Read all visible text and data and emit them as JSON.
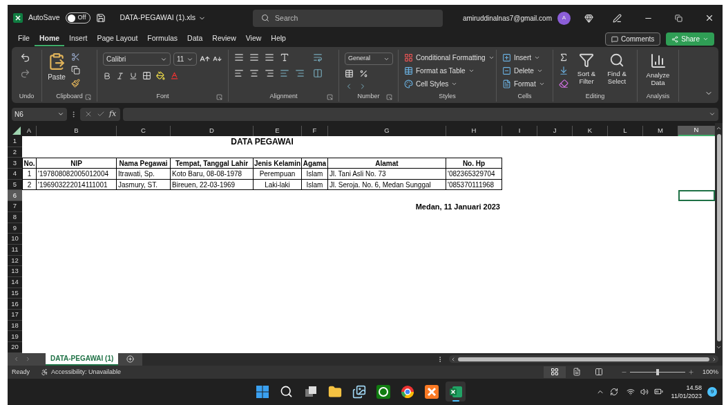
{
  "title_bar": {
    "autosave": {
      "label": "AutoSave",
      "on": false,
      "state_text": "Off"
    },
    "file_name": "DATA-PEGAWAI (1).xls",
    "search": {
      "placeholder": "Search"
    },
    "account": "amiruddinalnas7@gmail.com",
    "avatar": "A"
  },
  "menu_tabs": [
    {
      "label": "File",
      "selected": false
    },
    {
      "label": "Home",
      "selected": true
    },
    {
      "label": "Insert",
      "selected": false
    },
    {
      "label": "Page Layout",
      "selected": false
    },
    {
      "label": "Formulas",
      "selected": false
    },
    {
      "label": "Data",
      "selected": false
    },
    {
      "label": "Review",
      "selected": false
    },
    {
      "label": "View",
      "selected": false
    },
    {
      "label": "Help",
      "selected": false
    }
  ],
  "header_buttons": {
    "comments": "Comments",
    "share": "Share"
  },
  "ribbon": [
    {
      "kind": "undo",
      "label": "Undo"
    },
    {
      "kind": "clipboard",
      "label": "Clipboard",
      "paste": "Paste"
    },
    {
      "kind": "font",
      "label": "Font",
      "font_name": "Calibri",
      "font_size": "11"
    },
    {
      "kind": "alignment",
      "label": "Alignment"
    },
    {
      "kind": "number",
      "label": "Number",
      "format": "General"
    },
    {
      "kind": "styles",
      "label": "Styles",
      "items": [
        "Conditional Formatting",
        "Format as Table",
        "Cell Styles"
      ]
    },
    {
      "kind": "cells",
      "label": "Cells",
      "items": [
        "Insert",
        "Delete",
        "Format"
      ]
    },
    {
      "kind": "editing",
      "label": "Editing",
      "items": [
        "Sort & Filter",
        "Find & Select"
      ]
    },
    {
      "kind": "analysis",
      "label": "Analysis",
      "items": [
        "Analyze Data"
      ]
    }
  ],
  "formula_bar": {
    "name_box": "N6",
    "function_label": "fx"
  },
  "sheet": {
    "columns": [
      {
        "letter": "A",
        "selected": false
      },
      {
        "letter": "B",
        "selected": false
      },
      {
        "letter": "C",
        "selected": false
      },
      {
        "letter": "D",
        "selected": false
      },
      {
        "letter": "E",
        "selected": false
      },
      {
        "letter": "F",
        "selected": false
      },
      {
        "letter": "G",
        "selected": false
      },
      {
        "letter": "H",
        "selected": false
      },
      {
        "letter": "I",
        "selected": false
      },
      {
        "letter": "J",
        "selected": false
      },
      {
        "letter": "K",
        "selected": false
      },
      {
        "letter": "L",
        "selected": false
      },
      {
        "letter": "M",
        "selected": false
      },
      {
        "letter": "N",
        "selected": true
      }
    ],
    "rows": [
      {
        "number": "1",
        "selected": false,
        "kind": "title",
        "text": "DATA PEGAWAI"
      },
      {
        "number": "2",
        "selected": false,
        "kind": "blank"
      },
      {
        "number": "3",
        "selected": false,
        "kind": "header",
        "cells": [
          "No.",
          "NIP",
          "Nama Pegawai",
          "Tempat, Tanggal Lahir",
          "Jenis Kelamin",
          "Agama",
          "Alamat",
          "No. Hp"
        ]
      },
      {
        "number": "4",
        "selected": false,
        "kind": "record",
        "cells": [
          "1",
          "'197808082005012004",
          "Itrawati, Sp.",
          "Koto Baru, 08-08-1978",
          "Perempuan",
          "Islam",
          "Jl. Tani Asli No. 73",
          "'082365329704"
        ]
      },
      {
        "number": "5",
        "selected": false,
        "kind": "record",
        "cells": [
          "2",
          "'196903222014111001",
          "Jasmury, ST.",
          "Bireuen, 22-03-1969",
          "Laki-laki",
          "Islam",
          "Jl. Seroja. No. 6, Medan Sunggal",
          "'085370111968"
        ]
      },
      {
        "number": "6",
        "selected": true,
        "kind": "blank"
      },
      {
        "number": "7",
        "selected": false,
        "kind": "signature",
        "text": "Medan, 11 Januari 2023"
      },
      {
        "number": "8",
        "selected": false,
        "kind": "blank"
      },
      {
        "number": "9",
        "selected": false,
        "kind": "blank"
      },
      {
        "number": "10",
        "selected": false,
        "kind": "blank"
      },
      {
        "number": "11",
        "selected": false,
        "kind": "blank"
      },
      {
        "number": "12",
        "selected": false,
        "kind": "blank"
      },
      {
        "number": "13",
        "selected": false,
        "kind": "blank"
      },
      {
        "number": "14",
        "selected": false,
        "kind": "blank"
      },
      {
        "number": "15",
        "selected": false,
        "kind": "blank"
      },
      {
        "number": "16",
        "selected": false,
        "kind": "blank"
      },
      {
        "number": "17",
        "selected": false,
        "kind": "blank"
      },
      {
        "number": "18",
        "selected": false,
        "kind": "blank"
      },
      {
        "number": "19",
        "selected": false,
        "kind": "blank"
      },
      {
        "number": "20",
        "selected": false,
        "kind": "blank"
      }
    ]
  },
  "sheet_tabs": [
    {
      "label": "DATA-PEGAWAI (1)",
      "selected": true
    }
  ],
  "status_bar": {
    "ready": "Ready",
    "accessibility": "Accessibility: Unavailable",
    "views": [
      {
        "kind": "normal",
        "selected": true
      },
      {
        "kind": "page_layout",
        "selected": false
      },
      {
        "kind": "page_break",
        "selected": false
      }
    ],
    "zoom": {
      "level": 0.5,
      "reading": "100%"
    }
  },
  "taskbar": {
    "apps": [
      {
        "kind": "start",
        "selected": false
      },
      {
        "kind": "search",
        "selected": false
      },
      {
        "kind": "task_view",
        "selected": false
      },
      {
        "kind": "explorer",
        "selected": false
      },
      {
        "kind": "photos",
        "selected": false
      },
      {
        "kind": "xbox",
        "selected": false
      },
      {
        "kind": "chrome",
        "selected": false
      },
      {
        "kind": "xampp",
        "selected": false
      },
      {
        "kind": "excel",
        "selected": true
      }
    ],
    "time": "14.58",
    "date": "11/01/2023",
    "notifications": "9"
  }
}
